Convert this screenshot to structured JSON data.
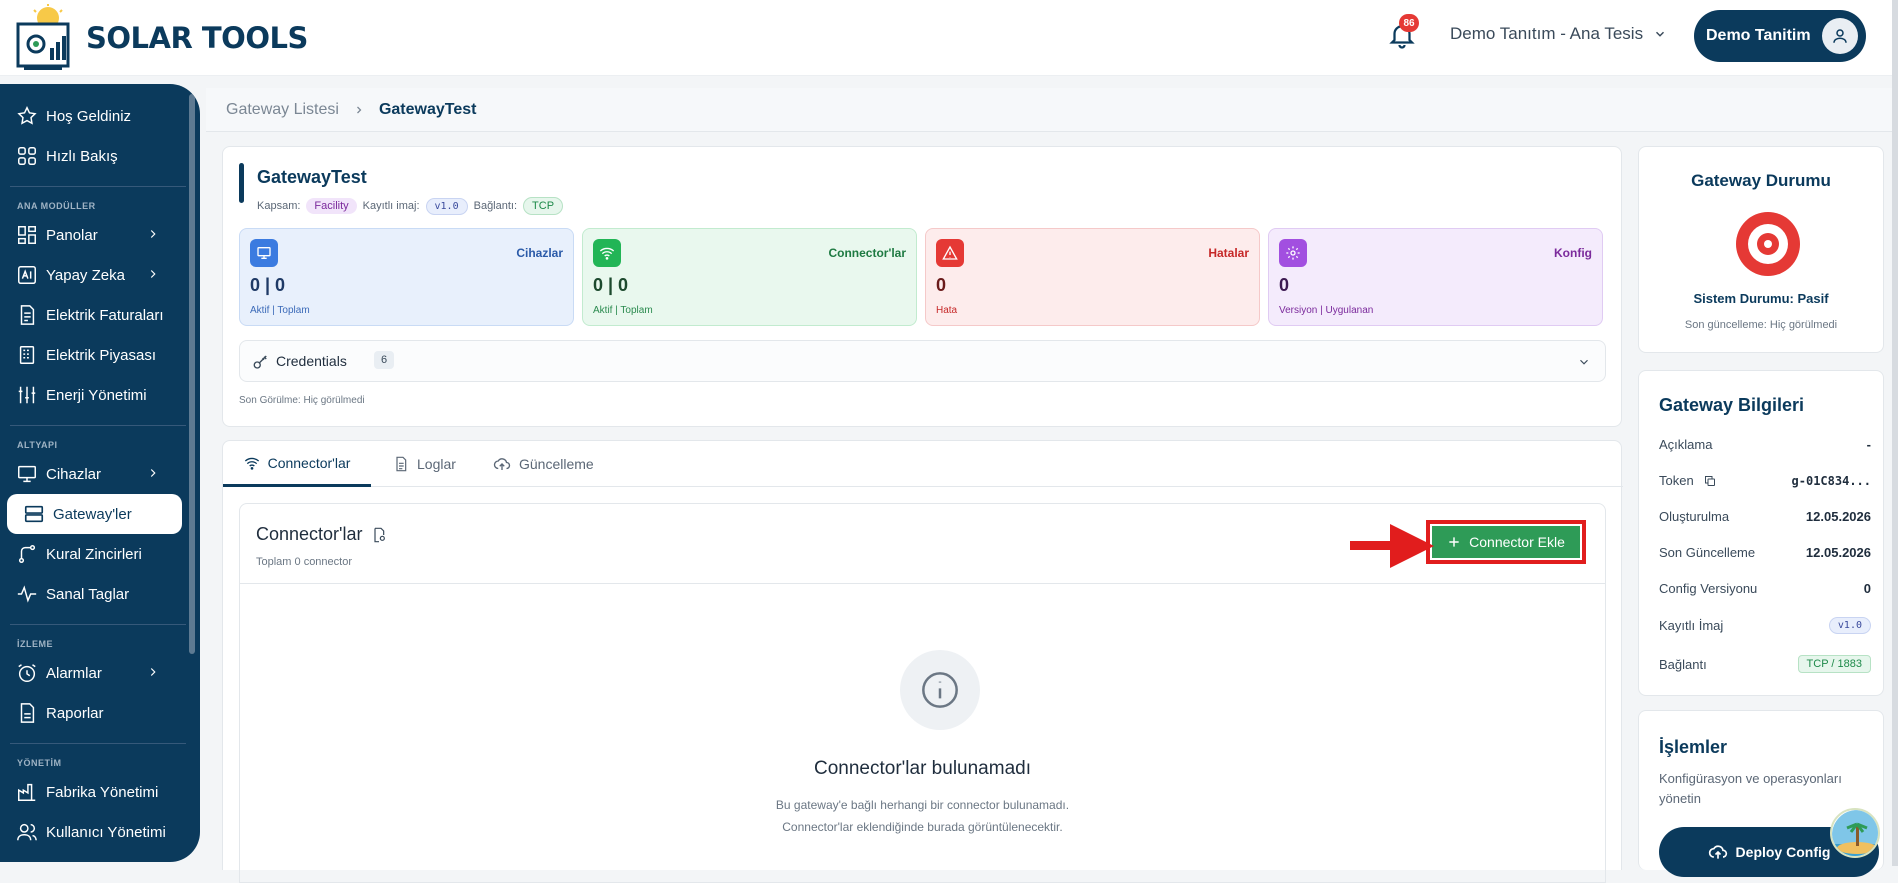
{
  "header": {
    "brand": "SOLAR TOOLS",
    "notifications_count": "86",
    "site_selector": "Demo Tanıtım - Ana Tesis",
    "user_name": "Demo Tanitim"
  },
  "sidebar": {
    "items_top": [
      {
        "label": "Hoş Geldiniz",
        "icon": "star-icon"
      },
      {
        "label": "Hızlı Bakış",
        "icon": "grid-icon"
      }
    ],
    "section_main": "ANA MODÜLLER",
    "items_main": [
      {
        "label": "Panolar",
        "icon": "dashboard-icon",
        "has_children": true
      },
      {
        "label": "Yapay Zeka",
        "icon": "ai-icon",
        "has_children": true
      },
      {
        "label": "Elektrik Faturaları",
        "icon": "invoice-icon"
      },
      {
        "label": "Elektrik Piyasası",
        "icon": "market-icon"
      },
      {
        "label": "Enerji Yönetimi",
        "icon": "sliders-icon"
      }
    ],
    "section_infra": "ALTYAPI",
    "items_infra": [
      {
        "label": "Cihazlar",
        "icon": "monitor-icon",
        "has_children": true
      },
      {
        "label": "Gateway'ler",
        "icon": "server-icon",
        "active": true
      },
      {
        "label": "Kural Zincirleri",
        "icon": "route-icon"
      },
      {
        "label": "Sanal Taglar",
        "icon": "activity-icon"
      }
    ],
    "section_monitor": "İZLEME",
    "items_monitor": [
      {
        "label": "Alarmlar",
        "icon": "alarm-icon",
        "has_children": true
      },
      {
        "label": "Raporlar",
        "icon": "report-icon"
      }
    ],
    "section_admin": "YÖNETİM",
    "items_admin": [
      {
        "label": "Fabrika Yönetimi",
        "icon": "factory-icon"
      },
      {
        "label": "Kullanıcı Yönetimi",
        "icon": "users-icon"
      }
    ]
  },
  "breadcrumb": {
    "parent": "Gateway Listesi",
    "current": "GatewayTest"
  },
  "gateway": {
    "name": "GatewayTest",
    "scope_label": "Kapsam:",
    "scope_value": "Facility",
    "image_label": "Kayıtlı imaj:",
    "image_value": "v1.0",
    "conn_label": "Bağlantı:",
    "conn_value": "TCP",
    "stats": [
      {
        "label": "Cihazlar",
        "value": "0 | 0",
        "sub": "Aktif  |  Toplam"
      },
      {
        "label": "Connector'lar",
        "value": "0 | 0",
        "sub": "Aktif  |  Toplam"
      },
      {
        "label": "Hatalar",
        "value": "0",
        "sub": "Hata"
      },
      {
        "label": "Konfig",
        "value": "0",
        "sub": "Versiyon  |  Uygulanan"
      }
    ],
    "credentials_label": "Credentials",
    "credentials_count": "6",
    "last_seen": "Son Görülme: Hiç görülmedi"
  },
  "tabs": [
    {
      "label": "Connector'lar",
      "icon": "wifi-icon",
      "active": true
    },
    {
      "label": "Loglar",
      "icon": "document-icon"
    },
    {
      "label": "Güncelleme",
      "icon": "cloud-upload-icon"
    }
  ],
  "connectors": {
    "title": "Connector'lar",
    "subtitle": "Toplam 0 connector",
    "add_button": "Connector Ekle",
    "empty_title": "Connector'lar bulunamadı",
    "empty_line1": "Bu gateway'e bağlı herhangi bir connector bulunamadı.",
    "empty_line2": "Connector'lar eklendiğinde burada görüntülenecektir."
  },
  "status": {
    "title": "Gateway Durumu",
    "state": "Sistem Durumu: Pasif",
    "updated": "Son güncelleme: Hiç görülmedi",
    "color": "#e53935"
  },
  "info": {
    "title": "Gateway Bilgileri",
    "rows": [
      {
        "label": "Açıklama",
        "value": "-"
      },
      {
        "label": "Token",
        "value": "g-01C834..."
      },
      {
        "label": "Oluşturulma",
        "value": "12.05.2026"
      },
      {
        "label": "Son Güncelleme",
        "value": "12.05.2026"
      },
      {
        "label": "Config Versiyonu",
        "value": "0"
      },
      {
        "label": "Kayıtlı İmaj",
        "value": "v1.0"
      },
      {
        "label": "Bağlantı",
        "value": "TCP / 1883"
      }
    ]
  },
  "ops": {
    "title": "İşlemler",
    "desc": "Konfigürasyon ve operasyonları yönetin",
    "deploy": "Deploy Config"
  }
}
